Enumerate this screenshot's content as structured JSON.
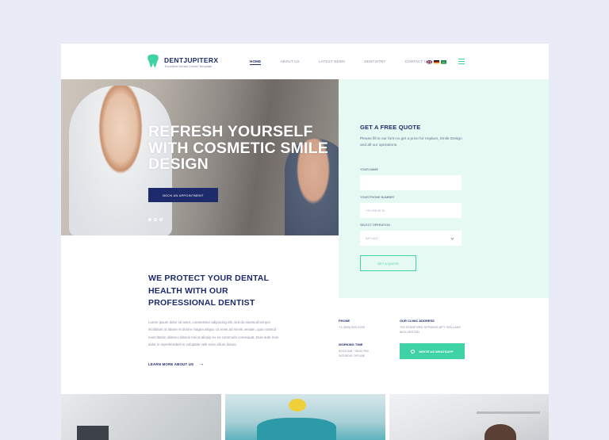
{
  "brand": {
    "name": "DENTJUPITERX",
    "tagline": "Excellent Dental Center Template",
    "accent_color": "#3fd2a4",
    "primary_color": "#1d2a6b"
  },
  "nav": {
    "items": [
      "HOME",
      "ABOUT US",
      "LATEST NEWS",
      "DENTISTRY",
      "CONTACT US"
    ],
    "active": "HOME",
    "flags": [
      "uk-flag-icon",
      "de-flag-icon",
      "sa-flag-icon"
    ],
    "menu_icon": "hamburger-menu-icon"
  },
  "hero": {
    "title": "REFRESH YOURSELF WITH COSMETIC SMILE DESIGN",
    "button": "BOOK AN APPOINTMENT",
    "slides": 3,
    "active_slide": 1
  },
  "quote": {
    "title": "GET A FREE QUOTE",
    "description": "Please fill in our form to get a price for Implant, Smile Design and all our operations.",
    "name_label": "YOUR NAME",
    "phone_label": "YOUR PHONE NUMBER",
    "phone_placeholder": "+90 555 55 55",
    "operation_label": "SELECT OPERATION",
    "operation_value": "IMPLANT",
    "submit": "GET A QUOTE"
  },
  "about": {
    "title": "WE PROTECT YOUR DENTAL HEALTH WITH OUR PROFESSIONAL DENTIST",
    "body": "Lorem ipsum dolor sit amet, consectetur adipiscing elit, sed do eiusmod tempor incididunt ut labore et dolore magna aliqua. Ut enim ad minim veniam, quis nostrud exercitation ullamco laboris nisi ut aliquip ex ea commodo consequat. Duis aute irure dolor in reprehenderit in voluptate velit esse cillum dolore.",
    "learn_more": "LEARN MORE ABOUT US"
  },
  "contact": {
    "phone_label": "PHONE",
    "phone_value": "+1 (555) 555 2255",
    "address_label": "OUR CLINIC ADDRESS",
    "address_value": "793 STANFORD SPRINGS APT. 905 LAKE MOLLIESTAD",
    "hours_label": "WORKING TIME",
    "hours_value": "09:00 AM - 08:00 PM",
    "hours_note": "SATURDAY OFFLINE",
    "whatsapp_button": "WRITE US WHATSAPP"
  }
}
